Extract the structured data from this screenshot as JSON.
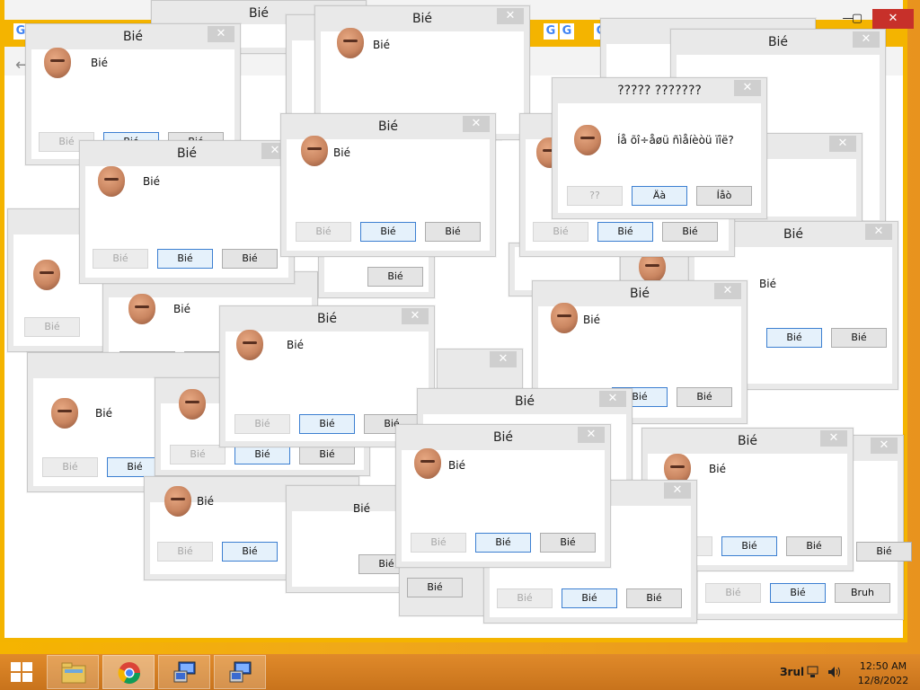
{
  "browser": {
    "tab_letter": "G",
    "window_controls": {
      "minimize": "—",
      "maximize": "▢",
      "close": "✕"
    },
    "back_icon": "back-arrow-icon"
  },
  "dialogs": {
    "title": "Віé",
    "message": "Віé",
    "button": "Віé",
    "close": "✕",
    "special": {
      "title": "????? ???????",
      "message": "Íå õî÷åøü ñìåíèòü ïîë?",
      "btn_help": "??",
      "btn_yes": "Äà",
      "btn_no": "Íåò"
    },
    "bruh": "Bruh"
  },
  "taskbar": {
    "tray_label": "Зrul",
    "time": "12:50 AM",
    "date": "12/8/2022",
    "items": [
      "file-explorer-icon",
      "chrome-icon",
      "network-app-icon",
      "network-app-icon"
    ]
  },
  "colors": {
    "accent_yellow": "#f4b400",
    "taskbar_orange": "#d27d24",
    "close_red": "#c7302a",
    "default_button_blue": "#3c7fd1"
  }
}
